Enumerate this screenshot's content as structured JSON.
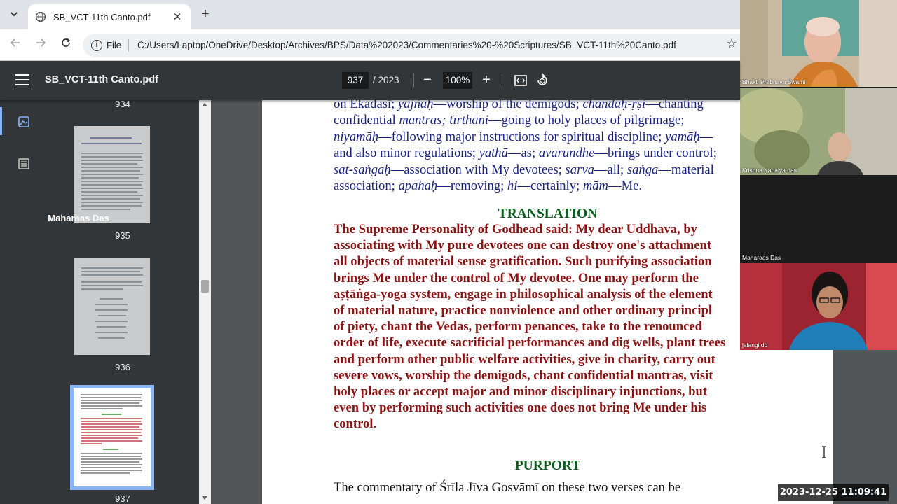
{
  "browser": {
    "tab_title": "SB_VCT-11th Canto.pdf",
    "tab_close": "✕",
    "new_tab": "+",
    "scheme_label": "File",
    "url": "C:/Users/Laptop/OneDrive/Desktop/Archives/BPS/Data%202023/Commentaries%20-%20Scriptures/SB_VCT-11th%20Canto.pdf"
  },
  "pdf_toolbar": {
    "document_name": "SB_VCT-11th Canto.pdf",
    "current_page": "937",
    "total_pages": "/ 2023",
    "zoom": "100%",
    "zoom_out": "−",
    "zoom_in": "+"
  },
  "thumbnails": {
    "top_label": "934",
    "items": [
      {
        "label": "935"
      },
      {
        "label": "936"
      },
      {
        "label": "937"
      }
    ]
  },
  "page": {
    "glossary_lines": [
      [
        "on Ekādaśī; ",
        {
          "i": "yajñaḥ"
        },
        "—worship of the demigods; ",
        {
          "i": "chandaḥ-ṛṣi"
        },
        "—chanting"
      ],
      [
        "confidential ",
        {
          "i": "mantras; tīrthāni"
        },
        "—going to holy places of pilgrimage;"
      ],
      [
        {
          "i": "niyamāḥ"
        },
        "—following major instructions for spiritual discipline; ",
        {
          "i": "yamāḥ"
        },
        "—"
      ],
      [
        "and also minor regulations; ",
        {
          "i": "yathā"
        },
        "—as; ",
        {
          "i": "avarundhe"
        },
        "—brings under control;"
      ],
      [
        {
          "i": "sat-saṅgaḥ"
        },
        "—association with My devotees; ",
        {
          "i": "sarva"
        },
        "—all; ",
        {
          "i": "saṅga"
        },
        "—material"
      ],
      [
        "association; ",
        {
          "i": "apahaḥ"
        },
        "—removing; ",
        {
          "i": "hi"
        },
        "—certainly; ",
        {
          "i": "mām"
        },
        "—Me."
      ]
    ],
    "translation_heading": "TRANSLATION",
    "translation_lines": [
      "The Supreme Personality of Godhead said: My dear Uddhava, by",
      "associating with My pure devotees one can destroy one's attachment",
      "all objects of material sense gratification. Such purifying association",
      "brings Me under the control of My devotee. One may perform the",
      "aṣṭāṅga-yoga system, engage in philosophical analysis of the element",
      "of material nature, practice nonviolence and other ordinary principl",
      "of piety, chant the Vedas, perform penances, take to the renounced",
      "order of life, execute sacrificial performances and dig wells, plant trees",
      "and perform other public welfare activities, give in charity, carry out",
      "severe vows, worship the demigods, chant confidential mantras, visit",
      "holy places or accept major and minor disciplinary injunctions, but",
      "even by performing such activities one does not bring Me under his",
      "control."
    ],
    "purport_heading": "PURPORT",
    "purport_line": "The commentary of Śrīla Jīva Gosvāmī on these two verses can be"
  },
  "video": {
    "tiles": [
      {
        "name": "Bhakti Prabhava Swami"
      },
      {
        "name": "Krishna Kanaiya das"
      },
      {
        "name": "Maharaas Das",
        "display": "Maharaas Das"
      },
      {
        "name": "jalangi dd"
      }
    ]
  },
  "timestamp": "2023-12-25  11:09:41",
  "colors": {
    "glossary": "#1a237e",
    "heading": "#0b5e1c",
    "translation": "#8b1414",
    "toolbar": "#323639",
    "doc_bg": "#525659"
  }
}
